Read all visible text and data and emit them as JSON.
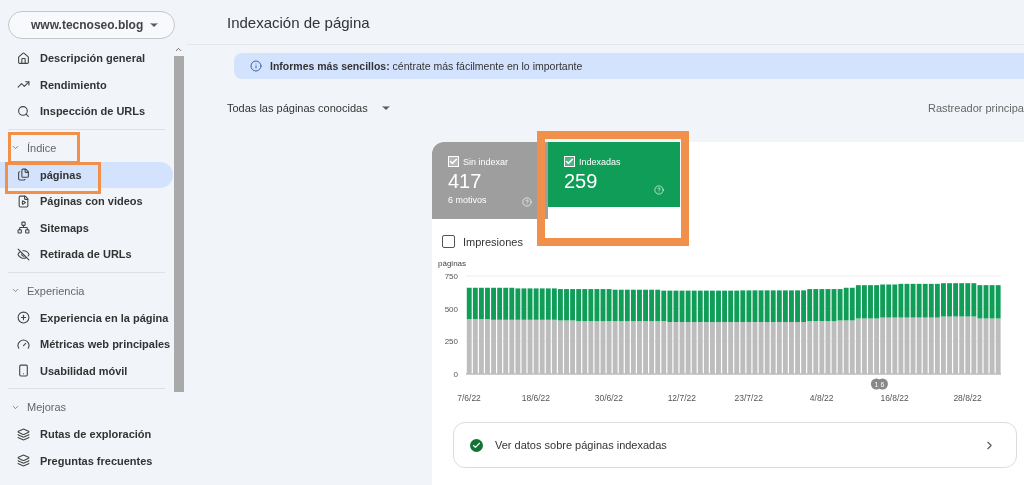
{
  "property": {
    "name": "www.tecnoseo.blog"
  },
  "nav_groups": [
    {
      "items": [
        {
          "label": "Descripción general",
          "selected": false
        },
        {
          "label": "Rendimiento",
          "selected": false
        },
        {
          "label": "Inspección de URLs",
          "selected": false
        }
      ]
    },
    {
      "title": "Índice",
      "expanded": true,
      "highlighted": true,
      "items": [
        {
          "label": "páginas",
          "selected": true,
          "highlighted": true
        },
        {
          "label": "Páginas con videos",
          "selected": false,
          "highlighted": false
        },
        {
          "label": "Sitemaps",
          "selected": false,
          "highlighted": false
        },
        {
          "label": "Retirada de URLs",
          "selected": false,
          "highlighted": false
        }
      ]
    },
    {
      "title": "Experiencia",
      "expanded": true,
      "highlighted": false,
      "items": [
        {
          "label": "Experiencia en la página",
          "selected": false
        },
        {
          "label": "Métricas web principales",
          "selected": false
        },
        {
          "label": "Usabilidad móvil",
          "selected": false
        }
      ]
    },
    {
      "title": "Mejoras",
      "expanded": true,
      "highlighted": false,
      "items": [
        {
          "label": "Rutas de exploración",
          "selected": false
        },
        {
          "label": "Preguntas frecuentes",
          "selected": false
        }
      ]
    }
  ],
  "page_title": "Indexación de página",
  "banner": {
    "text": "**Informes más sencillos:** céntrate más fácilmente en lo importante"
  },
  "filter": {
    "value": "Todas las páginas conocidas"
  },
  "crawler": {
    "label": "Rastreador principa"
  },
  "tiles": [
    {
      "label": "Sin indexar",
      "value": "417",
      "sub": "6 motivos",
      "checked": true,
      "highlighted": false,
      "color": "#9e9e9e"
    },
    {
      "label": "Indexadas",
      "value": "259",
      "checked": true,
      "highlighted": true,
      "color": "#0f9d58"
    }
  ],
  "impressions": {
    "label": "Impresiones",
    "checked": false
  },
  "chart": {
    "chart_data": {
      "type": "bar",
      "stacked": true,
      "ylabel": "páginas",
      "ylim": [
        0,
        750
      ],
      "yticks": [
        0,
        250,
        500,
        750
      ],
      "categories": [
        "7/6/22",
        null,
        null,
        null,
        null,
        null,
        null,
        null,
        null,
        null,
        null,
        "18/6/22",
        null,
        null,
        null,
        null,
        null,
        null,
        null,
        null,
        null,
        null,
        null,
        "30/6/22",
        null,
        null,
        null,
        null,
        null,
        null,
        null,
        null,
        null,
        null,
        null,
        "12/7/22",
        null,
        null,
        null,
        null,
        null,
        null,
        null,
        null,
        null,
        null,
        "23/7/22",
        null,
        null,
        null,
        null,
        null,
        null,
        null,
        null,
        null,
        null,
        null,
        "4/8/22",
        null,
        null,
        null,
        null,
        null,
        null,
        null,
        null,
        null,
        null,
        null,
        "16/8/22",
        null,
        null,
        null,
        null,
        null,
        null,
        null,
        null,
        null,
        null,
        null,
        "28/8/22",
        null,
        null,
        null,
        null,
        null
      ],
      "series": [
        {
          "color": "#bdbdbd",
          "values": [
            420,
            420,
            420,
            420,
            415,
            415,
            415,
            415,
            415,
            415,
            415,
            415,
            415,
            415,
            415,
            410,
            410,
            410,
            405,
            405,
            405,
            405,
            405,
            405,
            405,
            405,
            405,
            405,
            405,
            405,
            405,
            405,
            405,
            398,
            398,
            398,
            398,
            398,
            398,
            398,
            398,
            398,
            398,
            398,
            398,
            398,
            398,
            398,
            398,
            398,
            398,
            398,
            398,
            398,
            398,
            398,
            405,
            405,
            405,
            405,
            405,
            410,
            410,
            410,
            425,
            425,
            425,
            425,
            432,
            432,
            432,
            432,
            432,
            432,
            432,
            432,
            432,
            432,
            440,
            440,
            440,
            440,
            440,
            440,
            425,
            425,
            425,
            425
          ]
        },
        {
          "color": "#0f9d58",
          "values": [
            240,
            240,
            240,
            240,
            245,
            245,
            245,
            245,
            240,
            240,
            240,
            240,
            240,
            240,
            240,
            240,
            240,
            240,
            245,
            245,
            245,
            245,
            245,
            245,
            240,
            240,
            240,
            240,
            240,
            240,
            240,
            240,
            233,
            240,
            240,
            240,
            240,
            240,
            240,
            240,
            240,
            240,
            240,
            240,
            240,
            242,
            242,
            242,
            242,
            242,
            242,
            242,
            242,
            242,
            242,
            242,
            245,
            245,
            245,
            245,
            245,
            240,
            250,
            250,
            255,
            255,
            255,
            255,
            253,
            253,
            253,
            258,
            258,
            258,
            258,
            258,
            258,
            258,
            255,
            255,
            255,
            255,
            255,
            255,
            255,
            255,
            255,
            255
          ]
        }
      ],
      "annotations": [
        "1",
        "6"
      ]
    }
  },
  "details_link": {
    "label": "Ver datos sobre páginas indexadas"
  }
}
